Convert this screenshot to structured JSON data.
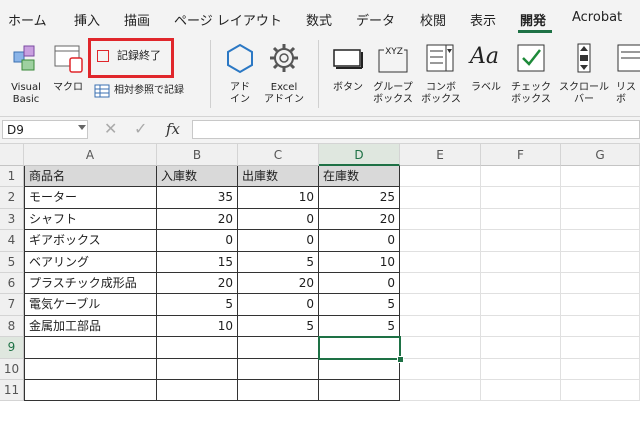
{
  "tabs": [
    {
      "label": "ホーム",
      "active": false
    },
    {
      "label": "挿入",
      "active": false
    },
    {
      "label": "描画",
      "active": false
    },
    {
      "label": "ページ レイアウト",
      "active": false
    },
    {
      "label": "数式",
      "active": false
    },
    {
      "label": "データ",
      "active": false
    },
    {
      "label": "校閲",
      "active": false
    },
    {
      "label": "表示",
      "active": false
    },
    {
      "label": "開発",
      "active": true
    },
    {
      "label": "Acrobat",
      "active": false
    }
  ],
  "ribbon": {
    "visual_basic": "Visual\nBasic",
    "macro": "マクロ",
    "stop_recording": "記録終了",
    "relative_ref": "相対参照で記録",
    "addin": "アド\nイン",
    "excel_addin": "Excel\nアドイン",
    "button": "ボタン",
    "groupbox": "グループ\nボックス",
    "combobox": "コンボ\nボックス",
    "label": "ラベル",
    "checkbox": "チェック\nボックス",
    "scrollbar": "スクロール\nバー",
    "listbox": "リス\nボ",
    "groupbox_icon_text": "XYZ",
    "label_icon_text": "Aa"
  },
  "formula_bar": {
    "name_box": "D9",
    "fx": "fx",
    "formula": ""
  },
  "columns": [
    "A",
    "B",
    "C",
    "D",
    "E",
    "F",
    "G"
  ],
  "selected_column": "D",
  "selected_row": 9,
  "rows": [
    1,
    2,
    3,
    4,
    5,
    6,
    7,
    8,
    9,
    10,
    11
  ],
  "table": [
    [
      "商品名",
      "入庫数",
      "出庫数",
      "在庫数"
    ],
    [
      "モーター",
      "35",
      "10",
      "25"
    ],
    [
      "シャフト",
      "20",
      "0",
      "20"
    ],
    [
      "ギアボックス",
      "0",
      "0",
      "0"
    ],
    [
      "ベアリング",
      "15",
      "5",
      "10"
    ],
    [
      "プラスチック成形品",
      "20",
      "20",
      "0"
    ],
    [
      "電気ケーブル",
      "5",
      "0",
      "5"
    ],
    [
      "金属加工部品",
      "10",
      "5",
      "5"
    ]
  ],
  "colors": {
    "accent": "#1e7145",
    "record_box": "#e0262b",
    "header_fill": "#d9d9d9"
  }
}
